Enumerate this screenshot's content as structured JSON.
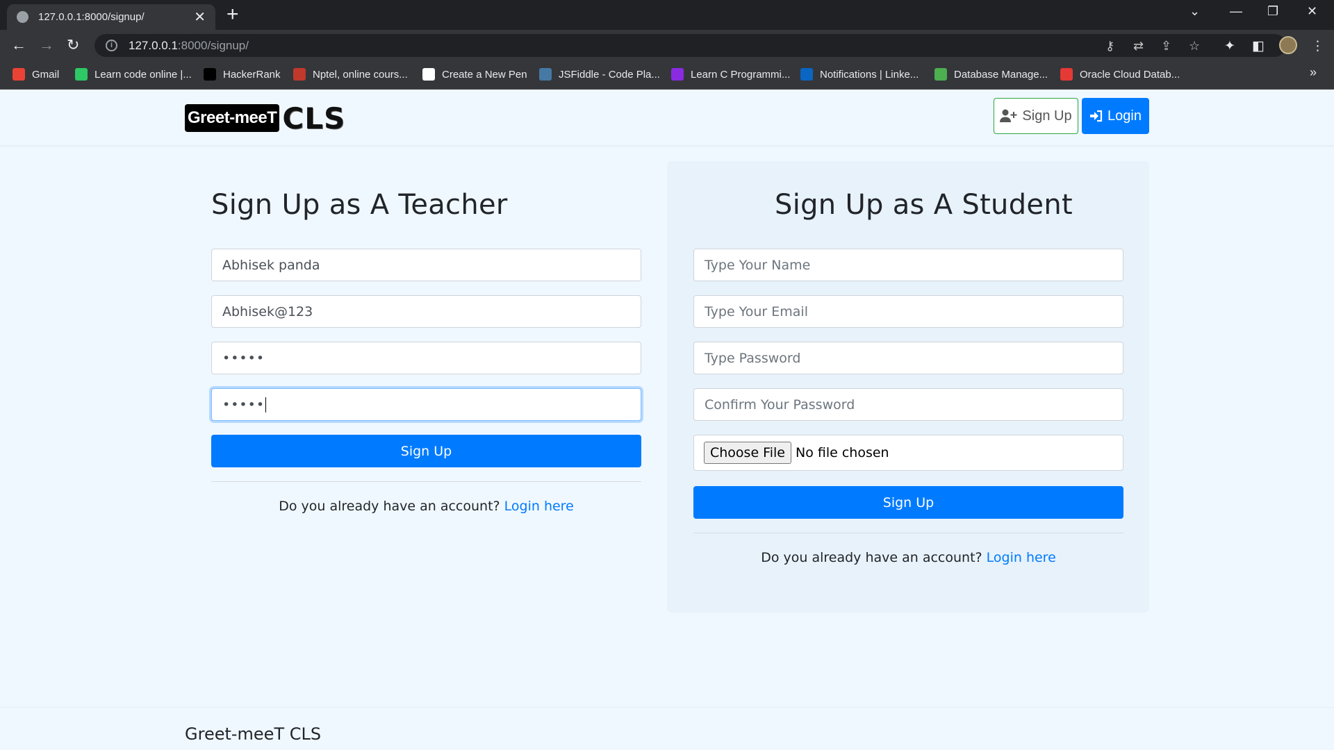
{
  "browser": {
    "tab_title": "127.0.0.1:8000/signup/",
    "url_host": "127.0.0.1",
    "url_path": ":8000/signup/",
    "bookmarks": [
      {
        "label": "Gmail",
        "color": "#ea4335"
      },
      {
        "label": "Learn code online |...",
        "color": "#2ec866"
      },
      {
        "label": "HackerRank",
        "color": "#000000"
      },
      {
        "label": "Nptel, online cours...",
        "color": "#c0392b"
      },
      {
        "label": "Create a New Pen",
        "color": "#ffffff"
      },
      {
        "label": "JSFiddle - Code Pla...",
        "color": "#4679a4"
      },
      {
        "label": "Learn C Programmi...",
        "color": "#8a2be2"
      },
      {
        "label": "Notifications | Linke...",
        "color": "#0a66c2"
      },
      {
        "label": "Database Manage...",
        "color": "#4caf50"
      },
      {
        "label": "Oracle Cloud Datab...",
        "color": "#e53935"
      }
    ]
  },
  "navbar": {
    "logo_part1": "Greet-meeT",
    "logo_part2": "CLS",
    "signup_label": "Sign Up",
    "login_label": "Login"
  },
  "teacher": {
    "title": "Sign Up as A Teacher",
    "name_value": "Abhisek panda",
    "email_value": "Abhisek@123",
    "password_value": "•••••",
    "confirm_value": "•••••",
    "submit_label": "Sign Up",
    "already_text": "Do you already have an account?",
    "login_link": "Login here"
  },
  "student": {
    "title": "Sign Up as A Student",
    "name_placeholder": "Type Your Name",
    "email_placeholder": "Type Your Email",
    "password_placeholder": "Type Password",
    "confirm_placeholder": "Confirm Your Password",
    "choose_file_label": "Choose File",
    "no_file_text": "No file chosen",
    "submit_label": "Sign Up",
    "already_text": "Do you already have an account?",
    "login_link": "Login here"
  },
  "footer": {
    "brand": "Greet-meeT CLS"
  },
  "colors": {
    "primary": "#007bff",
    "success_border": "#28a745",
    "page_bg": "#f0f8ff"
  }
}
